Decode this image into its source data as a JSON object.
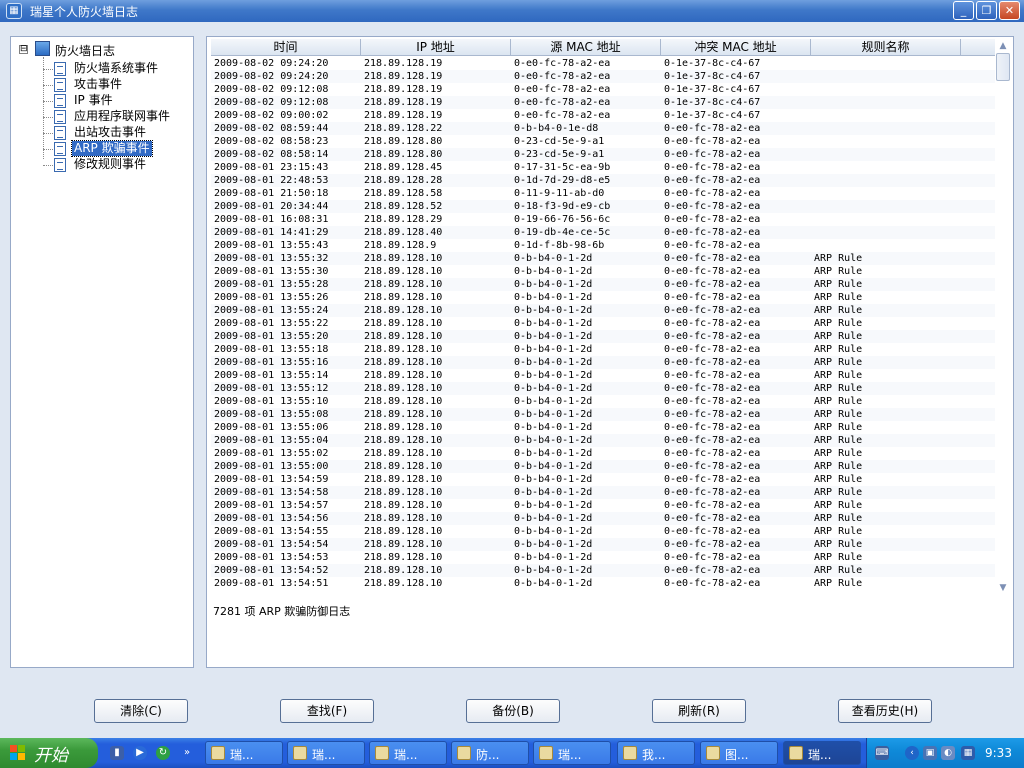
{
  "window": {
    "title": "瑞星个人防火墙日志"
  },
  "tree": {
    "root": "防火墙日志",
    "toggle": "⊟",
    "items": [
      {
        "label": "防火墙系统事件"
      },
      {
        "label": "攻击事件"
      },
      {
        "label": "IP 事件"
      },
      {
        "label": "应用程序联网事件"
      },
      {
        "label": "出站攻击事件"
      },
      {
        "label": "ARP 欺骗事件"
      },
      {
        "label": "修改规则事件"
      }
    ],
    "selected": "ARP 欺骗事件"
  },
  "table": {
    "columns": [
      "时间",
      "IP 地址",
      "源 MAC 地址",
      "冲突 MAC 地址",
      "规则名称"
    ],
    "rows": [
      [
        "2009-08-02 09:24:20",
        "218.89.128.19",
        "0-e0-fc-78-a2-ea",
        "0-1e-37-8c-c4-67",
        ""
      ],
      [
        "2009-08-02 09:24:20",
        "218.89.128.19",
        "0-e0-fc-78-a2-ea",
        "0-1e-37-8c-c4-67",
        ""
      ],
      [
        "2009-08-02 09:12:08",
        "218.89.128.19",
        "0-e0-fc-78-a2-ea",
        "0-1e-37-8c-c4-67",
        ""
      ],
      [
        "2009-08-02 09:12:08",
        "218.89.128.19",
        "0-e0-fc-78-a2-ea",
        "0-1e-37-8c-c4-67",
        ""
      ],
      [
        "2009-08-02 09:00:02",
        "218.89.128.19",
        "0-e0-fc-78-a2-ea",
        "0-1e-37-8c-c4-67",
        ""
      ],
      [
        "2009-08-02 08:59:44",
        "218.89.128.22",
        "0-b-b4-0-1e-d8",
        "0-e0-fc-78-a2-ea",
        ""
      ],
      [
        "2009-08-02 08:58:23",
        "218.89.128.80",
        "0-23-cd-5e-9-a1",
        "0-e0-fc-78-a2-ea",
        ""
      ],
      [
        "2009-08-02 08:58:14",
        "218.89.128.80",
        "0-23-cd-5e-9-a1",
        "0-e0-fc-78-a2-ea",
        ""
      ],
      [
        "2009-08-01 23:15:43",
        "218.89.128.45",
        "0-17-31-5c-ea-9b",
        "0-e0-fc-78-a2-ea",
        ""
      ],
      [
        "2009-08-01 22:48:53",
        "218.89.128.28",
        "0-1d-7d-29-d8-e5",
        "0-e0-fc-78-a2-ea",
        ""
      ],
      [
        "2009-08-01 21:50:18",
        "218.89.128.58",
        "0-11-9-11-ab-d0",
        "0-e0-fc-78-a2-ea",
        ""
      ],
      [
        "2009-08-01 20:34:44",
        "218.89.128.52",
        "0-18-f3-9d-e9-cb",
        "0-e0-fc-78-a2-ea",
        ""
      ],
      [
        "2009-08-01 16:08:31",
        "218.89.128.29",
        "0-19-66-76-56-6c",
        "0-e0-fc-78-a2-ea",
        ""
      ],
      [
        "2009-08-01 14:41:29",
        "218.89.128.40",
        "0-19-db-4e-ce-5c",
        "0-e0-fc-78-a2-ea",
        ""
      ],
      [
        "2009-08-01 13:55:43",
        "218.89.128.9",
        "0-1d-f-8b-98-6b",
        "0-e0-fc-78-a2-ea",
        ""
      ],
      [
        "2009-08-01 13:55:32",
        "218.89.128.10",
        "0-b-b4-0-1-2d",
        "0-e0-fc-78-a2-ea",
        "ARP Rule"
      ],
      [
        "2009-08-01 13:55:30",
        "218.89.128.10",
        "0-b-b4-0-1-2d",
        "0-e0-fc-78-a2-ea",
        "ARP Rule"
      ],
      [
        "2009-08-01 13:55:28",
        "218.89.128.10",
        "0-b-b4-0-1-2d",
        "0-e0-fc-78-a2-ea",
        "ARP Rule"
      ],
      [
        "2009-08-01 13:55:26",
        "218.89.128.10",
        "0-b-b4-0-1-2d",
        "0-e0-fc-78-a2-ea",
        "ARP Rule"
      ],
      [
        "2009-08-01 13:55:24",
        "218.89.128.10",
        "0-b-b4-0-1-2d",
        "0-e0-fc-78-a2-ea",
        "ARP Rule"
      ],
      [
        "2009-08-01 13:55:22",
        "218.89.128.10",
        "0-b-b4-0-1-2d",
        "0-e0-fc-78-a2-ea",
        "ARP Rule"
      ],
      [
        "2009-08-01 13:55:20",
        "218.89.128.10",
        "0-b-b4-0-1-2d",
        "0-e0-fc-78-a2-ea",
        "ARP Rule"
      ],
      [
        "2009-08-01 13:55:18",
        "218.89.128.10",
        "0-b-b4-0-1-2d",
        "0-e0-fc-78-a2-ea",
        "ARP Rule"
      ],
      [
        "2009-08-01 13:55:16",
        "218.89.128.10",
        "0-b-b4-0-1-2d",
        "0-e0-fc-78-a2-ea",
        "ARP Rule"
      ],
      [
        "2009-08-01 13:55:14",
        "218.89.128.10",
        "0-b-b4-0-1-2d",
        "0-e0-fc-78-a2-ea",
        "ARP Rule"
      ],
      [
        "2009-08-01 13:55:12",
        "218.89.128.10",
        "0-b-b4-0-1-2d",
        "0-e0-fc-78-a2-ea",
        "ARP Rule"
      ],
      [
        "2009-08-01 13:55:10",
        "218.89.128.10",
        "0-b-b4-0-1-2d",
        "0-e0-fc-78-a2-ea",
        "ARP Rule"
      ],
      [
        "2009-08-01 13:55:08",
        "218.89.128.10",
        "0-b-b4-0-1-2d",
        "0-e0-fc-78-a2-ea",
        "ARP Rule"
      ],
      [
        "2009-08-01 13:55:06",
        "218.89.128.10",
        "0-b-b4-0-1-2d",
        "0-e0-fc-78-a2-ea",
        "ARP Rule"
      ],
      [
        "2009-08-01 13:55:04",
        "218.89.128.10",
        "0-b-b4-0-1-2d",
        "0-e0-fc-78-a2-ea",
        "ARP Rule"
      ],
      [
        "2009-08-01 13:55:02",
        "218.89.128.10",
        "0-b-b4-0-1-2d",
        "0-e0-fc-78-a2-ea",
        "ARP Rule"
      ],
      [
        "2009-08-01 13:55:00",
        "218.89.128.10",
        "0-b-b4-0-1-2d",
        "0-e0-fc-78-a2-ea",
        "ARP Rule"
      ],
      [
        "2009-08-01 13:54:59",
        "218.89.128.10",
        "0-b-b4-0-1-2d",
        "0-e0-fc-78-a2-ea",
        "ARP Rule"
      ],
      [
        "2009-08-01 13:54:58",
        "218.89.128.10",
        "0-b-b4-0-1-2d",
        "0-e0-fc-78-a2-ea",
        "ARP Rule"
      ],
      [
        "2009-08-01 13:54:57",
        "218.89.128.10",
        "0-b-b4-0-1-2d",
        "0-e0-fc-78-a2-ea",
        "ARP Rule"
      ],
      [
        "2009-08-01 13:54:56",
        "218.89.128.10",
        "0-b-b4-0-1-2d",
        "0-e0-fc-78-a2-ea",
        "ARP Rule"
      ],
      [
        "2009-08-01 13:54:55",
        "218.89.128.10",
        "0-b-b4-0-1-2d",
        "0-e0-fc-78-a2-ea",
        "ARP Rule"
      ],
      [
        "2009-08-01 13:54:54",
        "218.89.128.10",
        "0-b-b4-0-1-2d",
        "0-e0-fc-78-a2-ea",
        "ARP Rule"
      ],
      [
        "2009-08-01 13:54:53",
        "218.89.128.10",
        "0-b-b4-0-1-2d",
        "0-e0-fc-78-a2-ea",
        "ARP Rule"
      ],
      [
        "2009-08-01 13:54:52",
        "218.89.128.10",
        "0-b-b4-0-1-2d",
        "0-e0-fc-78-a2-ea",
        "ARP Rule"
      ],
      [
        "2009-08-01 13:54:51",
        "218.89.128.10",
        "0-b-b4-0-1-2d",
        "0-e0-fc-78-a2-ea",
        "ARP Rule"
      ]
    ]
  },
  "status": {
    "text": "7281 项 ARP 欺骗防御日志"
  },
  "buttons": {
    "clear": "清除(C)",
    "search": "查找(F)",
    "backup": "备份(B)",
    "refresh": "刷新(R)",
    "history": "查看历史(H)"
  },
  "taskbar": {
    "start": "开始",
    "tasks": [
      "瑞...",
      "瑞...",
      "瑞...",
      "防...",
      "瑞...",
      "我...",
      "图...",
      "瑞..."
    ],
    "active_index": 7,
    "clock": "9:33"
  },
  "colors": {
    "title_bar": "#2f68bf",
    "selection": "#316ac5",
    "taskbar": "#245edc",
    "tray": "#0f8ad9"
  }
}
